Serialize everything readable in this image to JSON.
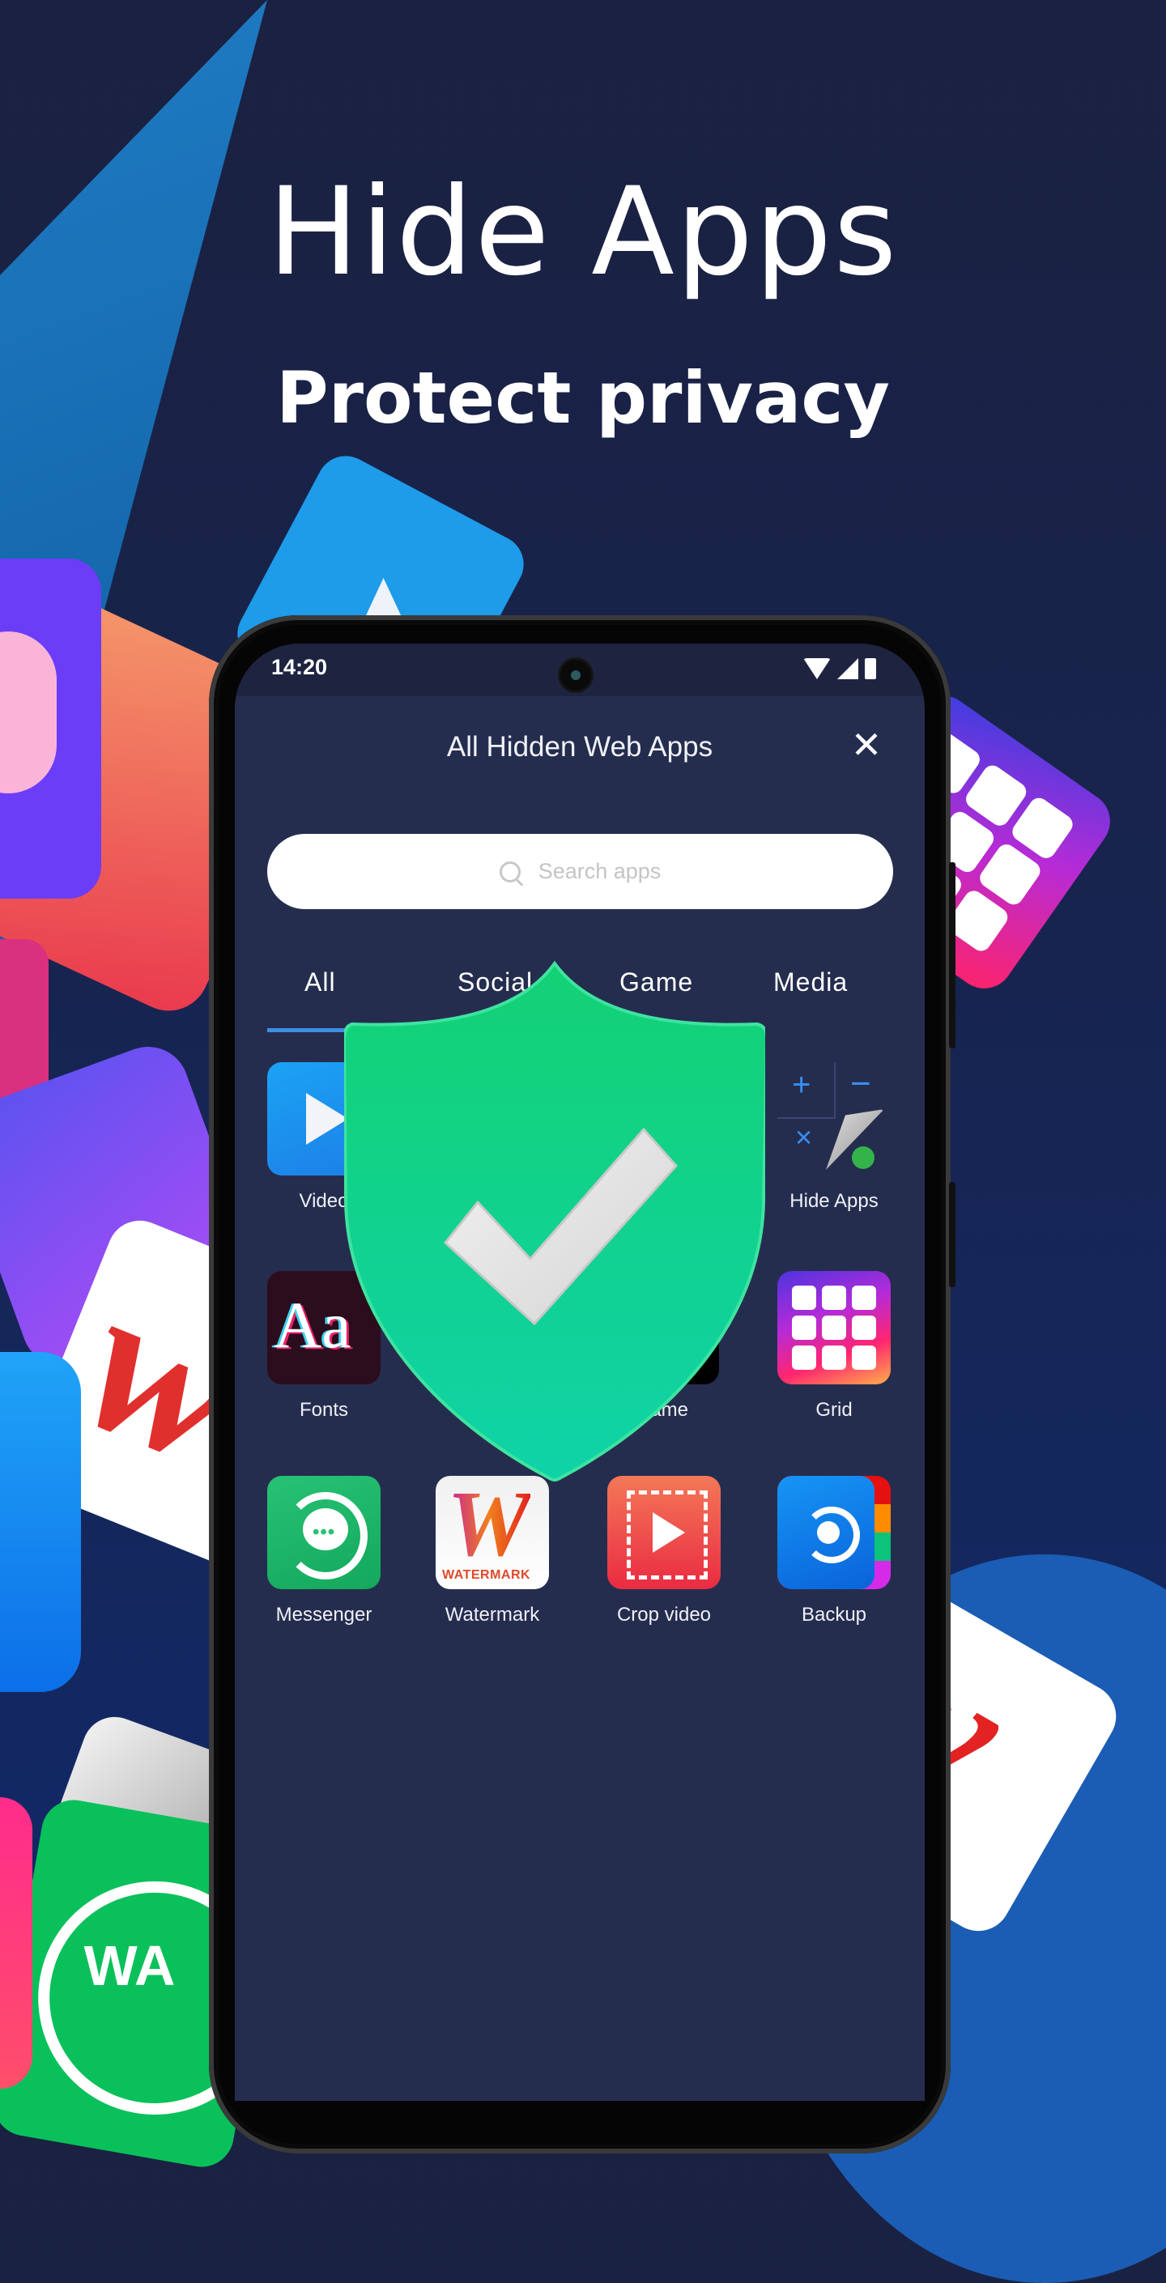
{
  "promo": {
    "title": "Hide Apps",
    "subtitle": "Protect privacy"
  },
  "status_bar": {
    "time": "14:20",
    "icons": [
      "wifi-icon",
      "signal-icon",
      "battery-icon"
    ]
  },
  "header": {
    "title": "All Hidden Web Apps",
    "close_icon": "close-icon"
  },
  "search": {
    "placeholder": "Search apps",
    "icon": "search-icon"
  },
  "tabs": [
    {
      "label": "All",
      "active": true
    },
    {
      "label": "Social",
      "active": false
    },
    {
      "label": "Game",
      "active": false
    },
    {
      "label": "Media",
      "active": false
    }
  ],
  "apps": [
    {
      "label": "Video",
      "icon": "video-play-icon"
    },
    {
      "label": "",
      "icon": "hidden-app-icon"
    },
    {
      "label": "",
      "icon": "hidden-app-icon"
    },
    {
      "label": "Hide Apps",
      "icon": "hide-apps-icon"
    },
    {
      "label": "Fonts",
      "icon": "fonts-icon"
    },
    {
      "label": "",
      "icon": "hidden-app-icon"
    },
    {
      "label": "Name",
      "icon": "name-app-icon"
    },
    {
      "label": "Grid",
      "icon": "grid-icon"
    },
    {
      "label": "Messenger",
      "icon": "messenger-icon"
    },
    {
      "label": "Watermark",
      "icon": "watermark-icon"
    },
    {
      "label": "Crop video",
      "icon": "crop-video-icon"
    },
    {
      "label": "Backup",
      "icon": "backup-icon"
    }
  ],
  "icon_text": {
    "fonts_glyph": "Aa",
    "watermark_glyph": "W",
    "watermark_text": "WATERMARK",
    "messenger_dots": "•••",
    "bg_watermark_glyph": "w",
    "bg_wa_text": "WA"
  },
  "colors": {
    "background": "#17244f",
    "screen": "#252d4f",
    "accent": "#3d8fe0",
    "shield_green": "#0fd17a"
  }
}
